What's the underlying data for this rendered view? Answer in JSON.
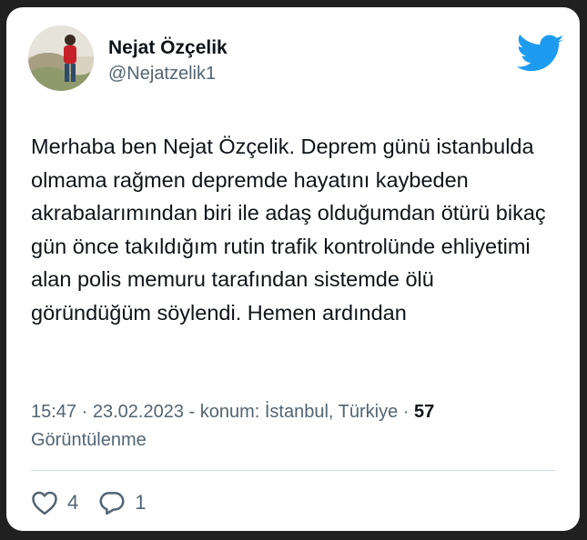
{
  "tweet": {
    "author": {
      "name": "Nejat Özçelik",
      "handle": "@Nejatzelik1",
      "avatar_icon": "profile-photo"
    },
    "logo_icon": "twitter-bird-icon",
    "brand_color": "#1d9bf0",
    "text": "Merhaba ben Nejat Özçelik. Deprem günü istanbulda olmama rağmen depremde hayatını kaybeden akrabalarımından biri ile adaş olduğumdan ötürü bikaç gün önce takıldığım rutin trafik kontrolünde ehliyetimi alan polis memuru tarafından sistemde ölü göründüğüm söylendi. Hemen ardından",
    "meta": {
      "time": "15:47",
      "sep1": " · ",
      "date": "23.02.2023",
      "sep2": " - ",
      "location": "konum: İstanbul, Türkiye",
      "sep3": " · ",
      "views_count": "57",
      "views_label": "Görüntülenme"
    },
    "actions": {
      "likes": {
        "icon": "heart-icon",
        "count": "4"
      },
      "replies": {
        "icon": "reply-icon",
        "count": "1"
      }
    }
  }
}
